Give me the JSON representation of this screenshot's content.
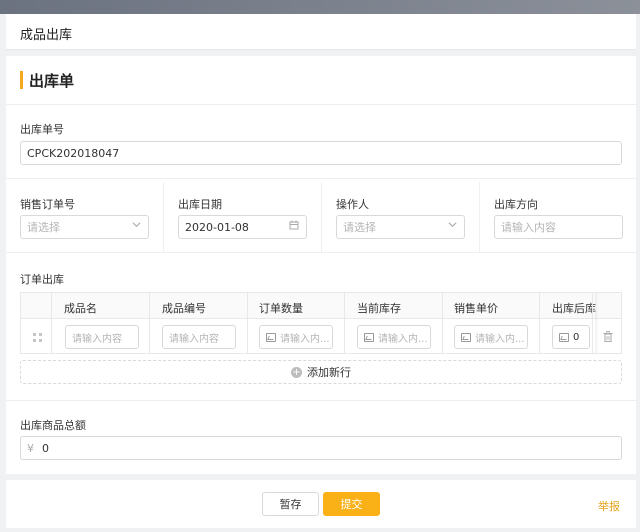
{
  "header": {
    "title": "成品出库"
  },
  "section": {
    "title": "出库单"
  },
  "fields": {
    "order_no": {
      "label": "出库单号",
      "value": "CPCK202018047"
    },
    "sales_order": {
      "label": "销售订单号",
      "placeholder": "请选择"
    },
    "out_date": {
      "label": "出库日期",
      "value": "2020-01-08"
    },
    "operator": {
      "label": "操作人",
      "placeholder": "请选择"
    },
    "direction": {
      "label": "出库方向",
      "placeholder": "请输入内容"
    }
  },
  "table": {
    "label": "订单出库",
    "columns": [
      "成品名",
      "成品编号",
      "订单数量",
      "当前库存",
      "销售单价",
      "出库后库"
    ],
    "row": {
      "name_placeholder": "请输入内容",
      "code_placeholder": "请输入内容",
      "qty_placeholder": "请输入内...",
      "stock_placeholder": "请输入内...",
      "price_placeholder": "请输入内...",
      "after_value": "0"
    },
    "add_row_label": "添加新行"
  },
  "total": {
    "label": "出库商品总额",
    "currency": "¥",
    "value": "0"
  },
  "footer": {
    "save_label": "暂存",
    "submit_label": "提交",
    "report_label": "举报"
  },
  "colors": {
    "accent": "#f7a823",
    "primary_button": "#f9b117"
  }
}
